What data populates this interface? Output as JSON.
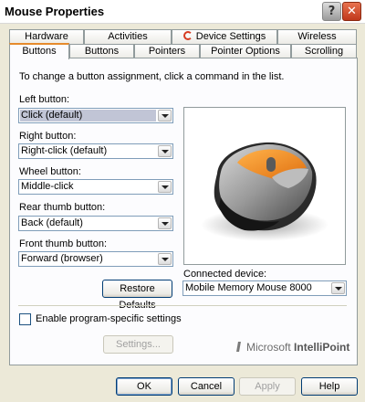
{
  "window": {
    "title": "Mouse Properties"
  },
  "tabs_back": [
    {
      "label": "Hardware"
    },
    {
      "label": "Activities"
    },
    {
      "label": "Device Settings"
    },
    {
      "label": "Wireless"
    }
  ],
  "tabs_front": [
    {
      "label": "Buttons",
      "selected": true
    },
    {
      "label": "Buttons"
    },
    {
      "label": "Pointers"
    },
    {
      "label": "Pointer Options"
    },
    {
      "label": "Scrolling"
    }
  ],
  "panel": {
    "instruction": "To change a button assignment, click a command in the list.",
    "left_button": {
      "label": "Left button:",
      "value": "Click (default)"
    },
    "right_button": {
      "label": "Right button:",
      "value": "Right-click (default)"
    },
    "wheel_button": {
      "label": "Wheel button:",
      "value": "Middle-click"
    },
    "rear_thumb_button": {
      "label": "Rear thumb button:",
      "value": "Back (default)"
    },
    "front_thumb_button": {
      "label": "Front thumb button:",
      "value": "Forward (browser)"
    },
    "restore_defaults": "Restore Defaults",
    "connected_device": {
      "label": "Connected device:",
      "value": "Mobile Memory Mouse 8000"
    },
    "program_specific": {
      "label": "Enable program-specific settings",
      "checked": false
    },
    "settings_button": "Settings...",
    "brand": {
      "prefix": "Microsoft",
      "product": "IntelliPoint"
    }
  },
  "footer": {
    "ok": "OK",
    "cancel": "Cancel",
    "apply": "Apply",
    "help": "Help"
  },
  "colors": {
    "mouse_accent": "#f08a1a",
    "tab_highlight": "#e68b2c"
  }
}
